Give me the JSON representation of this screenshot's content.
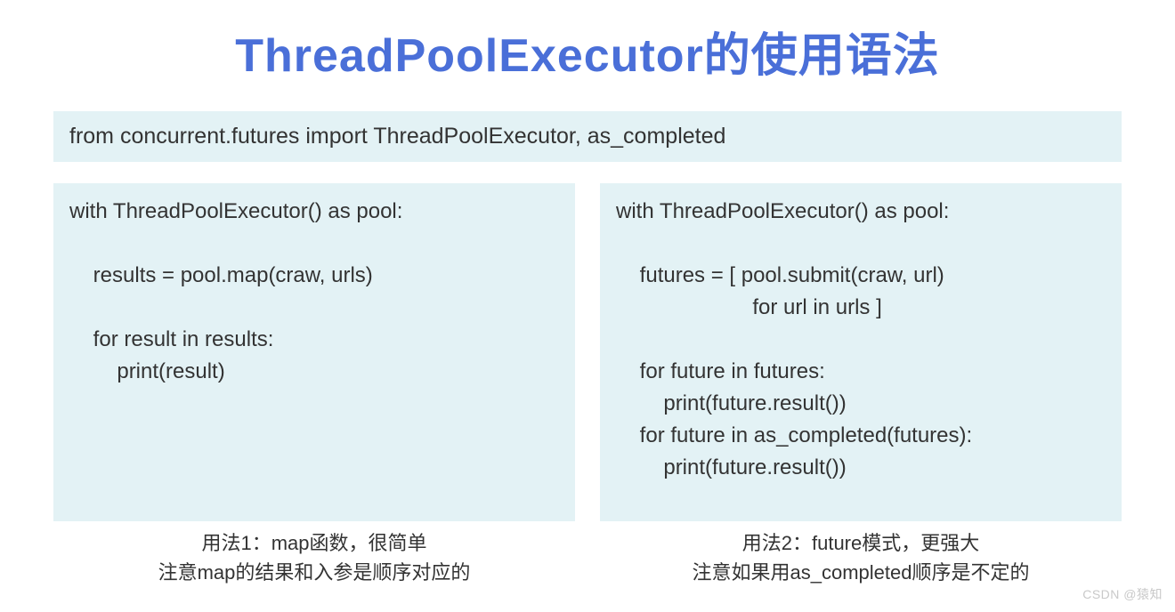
{
  "title": "ThreadPoolExecutor的使用语法",
  "import_line": "from concurrent.futures import ThreadPoolExecutor, as_completed",
  "left_code": [
    "with ThreadPoolExecutor() as pool:",
    "",
    "    results = pool.map(craw, urls)",
    "",
    "    for result in results:",
    "        print(result)"
  ],
  "right_code": [
    "with ThreadPoolExecutor() as pool:",
    "",
    "    futures = [ pool.submit(craw, url)",
    "                       for url in urls ]",
    "",
    "    for future in futures:",
    "        print(future.result())",
    "    for future in as_completed(futures):",
    "        print(future.result())"
  ],
  "left_caption_1": "用法1：map函数，很简单",
  "left_caption_2": "注意map的结果和入参是顺序对应的",
  "right_caption_1": "用法2：future模式，更强大",
  "right_caption_2": "注意如果用as_completed顺序是不定的",
  "watermark": "CSDN @猿知"
}
